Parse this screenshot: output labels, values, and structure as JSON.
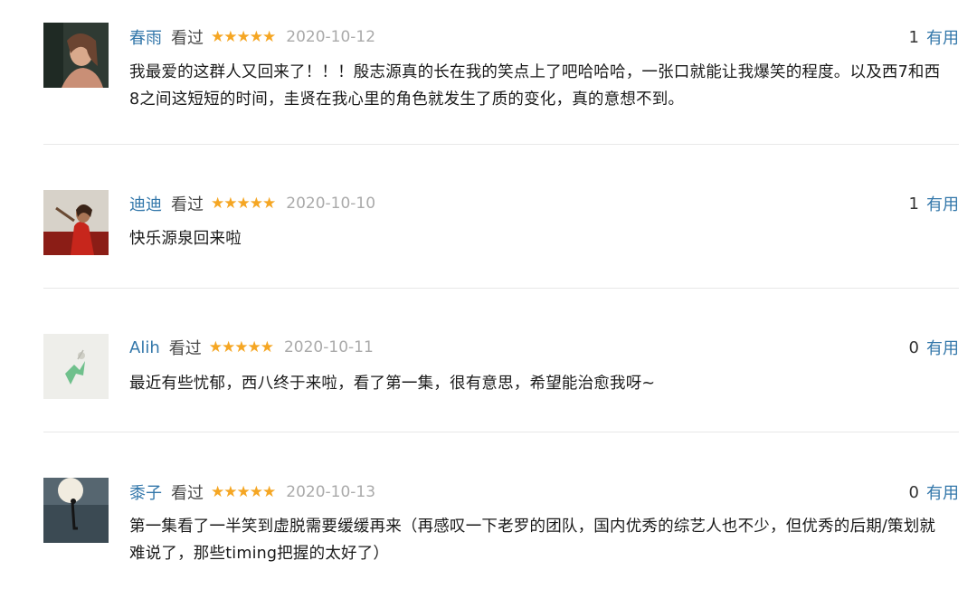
{
  "reviews": [
    {
      "user": "春雨",
      "status": "看过",
      "rating": 5,
      "date": "2020-10-12",
      "useful_count": "1",
      "useful_label": "有用",
      "text": "我最爱的这群人又回来了！！！殷志源真的长在我的笑点上了吧哈哈哈，一张口就能让我爆笑的程度。以及西7和西8之间这短短的时间，圭贤在我心里的角色就发生了质的变化，真的意想不到。"
    },
    {
      "user": "迪迪",
      "status": "看过",
      "rating": 5,
      "date": "2020-10-10",
      "useful_count": "1",
      "useful_label": "有用",
      "text": "快乐源泉回来啦"
    },
    {
      "user": "Alih",
      "status": "看过",
      "rating": 5,
      "date": "2020-10-11",
      "useful_count": "0",
      "useful_label": "有用",
      "text": "最近有些忧郁，西八终于来啦，看了第一集，很有意思，希望能治愈我呀~"
    },
    {
      "user": "黍子",
      "status": "看过",
      "rating": 5,
      "date": "2020-10-13",
      "useful_count": "0",
      "useful_label": "有用",
      "text": "第一集看了一半笑到虚脱需要缓缓再来（再感叹一下老罗的团队，国内优秀的综艺人也不少，但优秀的后期/策划就难说了，那些timing把握的太好了）"
    }
  ],
  "colors": {
    "username": "#3377aa",
    "star": "#f5a623",
    "date": "#aaaaaa",
    "divider": "#e8e8e8"
  }
}
